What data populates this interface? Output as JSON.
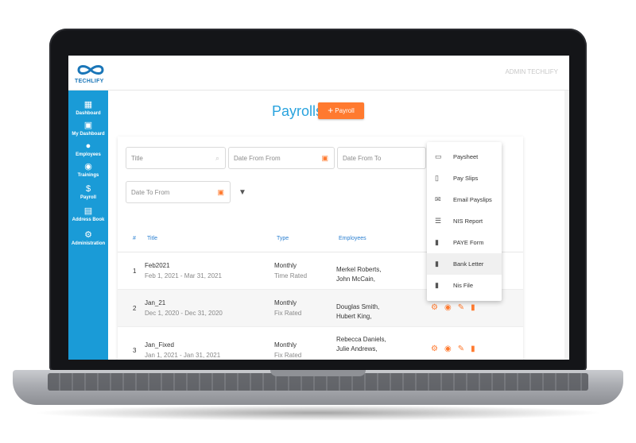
{
  "app": {
    "logo_text": "TECHLIFY",
    "topbar_user": "ADMIN TECHLIFY"
  },
  "sidebar": {
    "items": [
      {
        "label": "Dashboard",
        "icon": "dashboard-icon"
      },
      {
        "label": "My Dashboard",
        "icon": "my-dashboard-icon"
      },
      {
        "label": "Employees",
        "icon": "employees-icon"
      },
      {
        "label": "Trainings",
        "icon": "trainings-icon"
      },
      {
        "label": "Payroll",
        "icon": "payroll-icon"
      },
      {
        "label": "Address Book",
        "icon": "address-book-icon"
      },
      {
        "label": "Administration",
        "icon": "administration-icon"
      }
    ]
  },
  "page": {
    "title": "Payrolls",
    "add_button": "Payroll"
  },
  "filters": {
    "title_placeholder": "Title",
    "date_from_from": "Date From From",
    "date_from_to": "Date From To",
    "date_to_from": "Date To From"
  },
  "table": {
    "headers": [
      "#",
      "Title",
      "Type",
      "Employees"
    ],
    "rows": [
      {
        "num": "1",
        "title": "Feb2021",
        "dates": "Feb 1, 2021 - Mar 31, 2021",
        "type1": "Monthly",
        "type2": "Time Rated",
        "emp1": "Merkel Roberts,",
        "emp2": "John McCain,"
      },
      {
        "num": "2",
        "title": "Jan_21",
        "dates": "Dec 1, 2020 - Dec 31, 2020",
        "type1": "Monthly",
        "type2": "Fix Rated",
        "emp1": "Douglas Smith,",
        "emp2": "Hubert King,"
      },
      {
        "num": "3",
        "title": "Jan_Fixed",
        "dates": "Jan 1, 2021 - Jan 31, 2021",
        "type1": "Monthly",
        "type2": "Fix Rated",
        "emp1": "Rebecca Daniels,",
        "emp2": "Julie Andrews,"
      }
    ]
  },
  "menu": {
    "items": [
      {
        "label": "Paysheet",
        "icon": "paysheet-icon"
      },
      {
        "label": "Pay Slips",
        "icon": "pay-slips-icon"
      },
      {
        "label": "Email Payslips",
        "icon": "email-icon"
      },
      {
        "label": "NIS Report",
        "icon": "list-icon"
      },
      {
        "label": "PAYE Form",
        "icon": "document-icon"
      },
      {
        "label": "Bank Letter",
        "icon": "document-icon"
      },
      {
        "label": "Nis File",
        "icon": "document-icon"
      }
    ],
    "highlighted": "Bank Letter"
  },
  "colors": {
    "sidebar": "#1a9bd7",
    "accent": "#ff7a2f",
    "title": "#29a3de",
    "header_text": "#2a7fd1"
  }
}
